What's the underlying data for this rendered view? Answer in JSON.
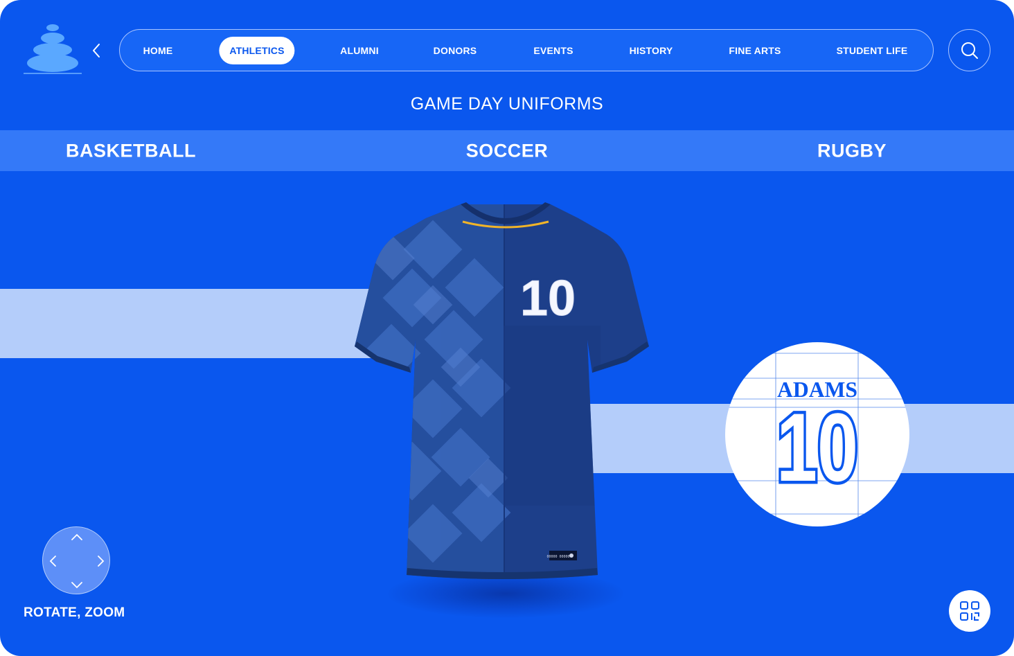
{
  "nav": {
    "items": [
      {
        "label": "HOME"
      },
      {
        "label": "ATHLETICS"
      },
      {
        "label": "ALUMNI"
      },
      {
        "label": "DONORS"
      },
      {
        "label": "EVENTS"
      },
      {
        "label": "HISTORY"
      },
      {
        "label": "FINE ARTS"
      },
      {
        "label": "STUDENT LIFE"
      }
    ],
    "active": "ATHLETICS"
  },
  "page": {
    "title": "GAME DAY UNIFORMS"
  },
  "sports": {
    "tabs": [
      {
        "label": "BASKETBALL"
      },
      {
        "label": "SOCCER"
      },
      {
        "label": "RUGBY"
      }
    ],
    "selected": "SOCCER"
  },
  "jersey": {
    "front_number": "10",
    "label_text": "00000 00000"
  },
  "detail": {
    "player_name": "ADAMS",
    "player_number": "10"
  },
  "controls": {
    "rotate_label": "ROTATE, ZOOM"
  },
  "icons": [
    "logo-stones-icon",
    "chevron-left-icon",
    "search-icon",
    "chevron-up-icon",
    "chevron-down-icon",
    "chevron-right-icon",
    "qr-code-icon"
  ],
  "colors": {
    "background": "#0a57ee",
    "nav_fill": "#1766f6",
    "tab_bar": "#3479f8",
    "band": "#b4cdfa",
    "jersey": "#1d3f8a",
    "accent_text": "#0a57ee"
  }
}
